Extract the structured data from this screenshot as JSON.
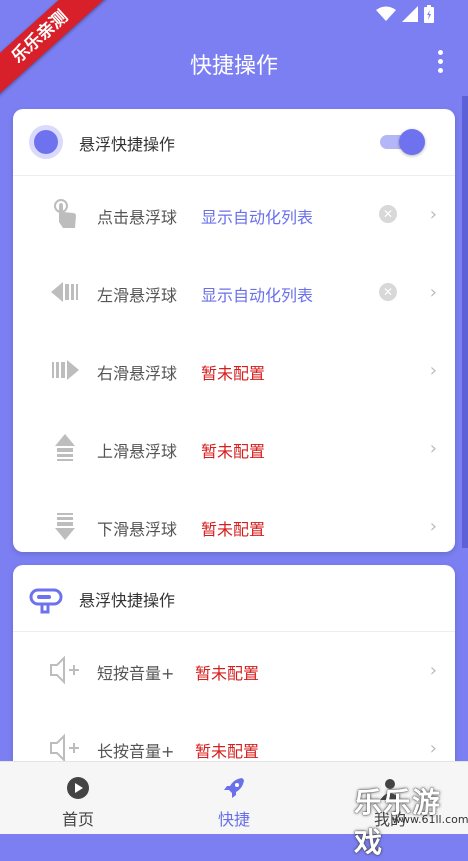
{
  "ribbon": {
    "text": "乐乐亲测"
  },
  "appbar": {
    "title": "快捷操作"
  },
  "section1": {
    "title": "悬浮快捷操作",
    "toggle_on": true,
    "rows": [
      {
        "icon": "tap-gesture-icon",
        "label": "点击悬浮球",
        "value": "显示自动化列表",
        "value_color": "blue",
        "clearable": true
      },
      {
        "icon": "swipe-left-icon",
        "label": "左滑悬浮球",
        "value": "显示自动化列表",
        "value_color": "blue",
        "clearable": true
      },
      {
        "icon": "swipe-right-icon",
        "label": "右滑悬浮球",
        "value": "暂未配置",
        "value_color": "red",
        "clearable": false
      },
      {
        "icon": "swipe-up-icon",
        "label": "上滑悬浮球",
        "value": "暂未配置",
        "value_color": "red",
        "clearable": false
      },
      {
        "icon": "swipe-down-icon",
        "label": "下滑悬浮球",
        "value": "暂未配置",
        "value_color": "red",
        "clearable": false
      }
    ]
  },
  "section2": {
    "title": "悬浮快捷操作",
    "rows": [
      {
        "icon": "volume-up-icon",
        "label": "短按音量+",
        "value": "暂未配置",
        "value_color": "red"
      },
      {
        "icon": "volume-up-icon",
        "label": "长按音量+",
        "value": "暂未配置",
        "value_color": "red"
      }
    ]
  },
  "nav": {
    "home": "首页",
    "quick": "快捷",
    "mine": "我的",
    "active": "quick"
  },
  "watermark": {
    "text": "乐乐游戏",
    "url": "www.61ll.com"
  },
  "colors": {
    "accent": "#6a70ea",
    "background": "#7b7ff2",
    "warning": "#d61e1e"
  }
}
